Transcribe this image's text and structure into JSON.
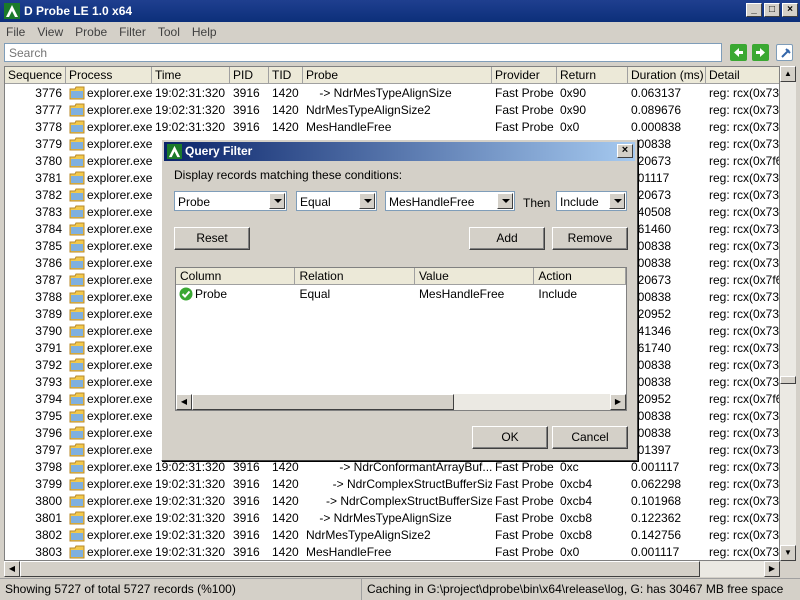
{
  "app": {
    "title": "D Probe LE 1.0 x64"
  },
  "menu": [
    "File",
    "View",
    "Probe",
    "Filter",
    "Tool",
    "Help"
  ],
  "search": {
    "placeholder": "Search"
  },
  "columns": [
    "Sequence",
    "Process",
    "Time",
    "PID",
    "TID",
    "Probe",
    "Provider",
    "Return",
    "Duration (ms)",
    "Detail"
  ],
  "rows": [
    {
      "seq": "3776",
      "proc": "explorer.exe",
      "time": "19:02:31:320",
      "pid": "3916",
      "tid": "1420",
      "probe": "    -> NdrMesTypeAlignSize",
      "prov": "Fast Probe",
      "ret": "0x90",
      "dur": "0.063137",
      "det": "reg: rcx(0x73"
    },
    {
      "seq": "3777",
      "proc": "explorer.exe",
      "time": "19:02:31:320",
      "pid": "3916",
      "tid": "1420",
      "probe": "NdrMesTypeAlignSize2",
      "prov": "Fast Probe",
      "ret": "0x90",
      "dur": "0.089676",
      "det": "reg: rcx(0x73"
    },
    {
      "seq": "3778",
      "proc": "explorer.exe",
      "time": "19:02:31:320",
      "pid": "3916",
      "tid": "1420",
      "probe": "MesHandleFree",
      "prov": "Fast Probe",
      "ret": "0x0",
      "dur": "0.000838",
      "det": "reg: rcx(0x73"
    },
    {
      "seq": "3779",
      "proc": "explorer.exe",
      "time": "",
      "pid": "",
      "tid": "",
      "probe": "",
      "prov": "",
      "ret": "",
      "dur": "000838",
      "det": "reg: rcx(0x73"
    },
    {
      "seq": "3780",
      "proc": "explorer.exe",
      "time": "",
      "pid": "",
      "tid": "",
      "probe": "",
      "prov": "",
      "ret": "",
      "dur": "020673",
      "det": "reg: rcx(0x7f6"
    },
    {
      "seq": "3781",
      "proc": "explorer.exe",
      "time": "",
      "pid": "",
      "tid": "",
      "probe": "",
      "prov": "",
      "ret": "",
      "dur": "001117",
      "det": "reg: rcx(0x73"
    },
    {
      "seq": "3782",
      "proc": "explorer.exe",
      "time": "",
      "pid": "",
      "tid": "",
      "probe": "",
      "prov": "",
      "ret": "",
      "dur": "020673",
      "det": "reg: rcx(0x73"
    },
    {
      "seq": "3783",
      "proc": "explorer.exe",
      "time": "",
      "pid": "",
      "tid": "",
      "probe": "",
      "prov": "",
      "ret": "",
      "dur": "040508",
      "det": "reg: rcx(0x73"
    },
    {
      "seq": "3784",
      "proc": "explorer.exe",
      "time": "",
      "pid": "",
      "tid": "",
      "probe": "",
      "prov": "",
      "ret": "",
      "dur": "061460",
      "det": "reg: rcx(0x73"
    },
    {
      "seq": "3785",
      "proc": "explorer.exe",
      "time": "",
      "pid": "",
      "tid": "",
      "probe": "",
      "prov": "",
      "ret": "",
      "dur": "000838",
      "det": "reg: rcx(0x73"
    },
    {
      "seq": "3786",
      "proc": "explorer.exe",
      "time": "",
      "pid": "",
      "tid": "",
      "probe": "",
      "prov": "",
      "ret": "",
      "dur": "000838",
      "det": "reg: rcx(0x73"
    },
    {
      "seq": "3787",
      "proc": "explorer.exe",
      "time": "",
      "pid": "",
      "tid": "",
      "probe": "",
      "prov": "",
      "ret": "",
      "dur": "020673",
      "det": "reg: rcx(0x7f6"
    },
    {
      "seq": "3788",
      "proc": "explorer.exe",
      "time": "",
      "pid": "",
      "tid": "",
      "probe": "",
      "prov": "",
      "ret": "",
      "dur": "000838",
      "det": "reg: rcx(0x73"
    },
    {
      "seq": "3789",
      "proc": "explorer.exe",
      "time": "",
      "pid": "",
      "tid": "",
      "probe": "",
      "prov": "",
      "ret": "",
      "dur": "020952",
      "det": "reg: rcx(0x73"
    },
    {
      "seq": "3790",
      "proc": "explorer.exe",
      "time": "",
      "pid": "",
      "tid": "",
      "probe": "",
      "prov": "",
      "ret": "",
      "dur": "041346",
      "det": "reg: rcx(0x73"
    },
    {
      "seq": "3791",
      "proc": "explorer.exe",
      "time": "",
      "pid": "",
      "tid": "",
      "probe": "",
      "prov": "",
      "ret": "",
      "dur": "061740",
      "det": "reg: rcx(0x73"
    },
    {
      "seq": "3792",
      "proc": "explorer.exe",
      "time": "",
      "pid": "",
      "tid": "",
      "probe": "",
      "prov": "",
      "ret": "",
      "dur": "000838",
      "det": "reg: rcx(0x73"
    },
    {
      "seq": "3793",
      "proc": "explorer.exe",
      "time": "",
      "pid": "",
      "tid": "",
      "probe": "",
      "prov": "",
      "ret": "",
      "dur": "000838",
      "det": "reg: rcx(0x73"
    },
    {
      "seq": "3794",
      "proc": "explorer.exe",
      "time": "",
      "pid": "",
      "tid": "",
      "probe": "",
      "prov": "",
      "ret": "",
      "dur": "020952",
      "det": "reg: rcx(0x7f6"
    },
    {
      "seq": "3795",
      "proc": "explorer.exe",
      "time": "",
      "pid": "",
      "tid": "",
      "probe": "",
      "prov": "",
      "ret": "",
      "dur": "000838",
      "det": "reg: rcx(0x73"
    },
    {
      "seq": "3796",
      "proc": "explorer.exe",
      "time": "",
      "pid": "",
      "tid": "",
      "probe": "",
      "prov": "",
      "ret": "",
      "dur": "000838",
      "det": "reg: rcx(0x73"
    },
    {
      "seq": "3797",
      "proc": "explorer.exe",
      "time": "",
      "pid": "",
      "tid": "",
      "probe": "",
      "prov": "",
      "ret": "",
      "dur": "001397",
      "det": "reg: rcx(0x73"
    },
    {
      "seq": "3798",
      "proc": "explorer.exe",
      "time": "19:02:31:320",
      "pid": "3916",
      "tid": "1420",
      "probe": "          -> NdrConformantArrayBuf...",
      "prov": "Fast Probe",
      "ret": "0xc",
      "dur": "0.001117",
      "det": "reg: rcx(0x73"
    },
    {
      "seq": "3799",
      "proc": "explorer.exe",
      "time": "19:02:31:320",
      "pid": "3916",
      "tid": "1420",
      "probe": "        -> NdrComplexStructBufferSize",
      "prov": "Fast Probe",
      "ret": "0xcb4",
      "dur": "0.062298",
      "det": "reg: rcx(0x73"
    },
    {
      "seq": "3800",
      "proc": "explorer.exe",
      "time": "19:02:31:320",
      "pid": "3916",
      "tid": "1420",
      "probe": "      -> NdrComplexStructBufferSize",
      "prov": "Fast Probe",
      "ret": "0xcb4",
      "dur": "0.101968",
      "det": "reg: rcx(0x73"
    },
    {
      "seq": "3801",
      "proc": "explorer.exe",
      "time": "19:02:31:320",
      "pid": "3916",
      "tid": "1420",
      "probe": "    -> NdrMesTypeAlignSize",
      "prov": "Fast Probe",
      "ret": "0xcb8",
      "dur": "0.122362",
      "det": "reg: rcx(0x73"
    },
    {
      "seq": "3802",
      "proc": "explorer.exe",
      "time": "19:02:31:320",
      "pid": "3916",
      "tid": "1420",
      "probe": "NdrMesTypeAlignSize2",
      "prov": "Fast Probe",
      "ret": "0xcb8",
      "dur": "0.142756",
      "det": "reg: rcx(0x73"
    },
    {
      "seq": "3803",
      "proc": "explorer.exe",
      "time": "19:02:31:320",
      "pid": "3916",
      "tid": "1420",
      "probe": "MesHandleFree",
      "prov": "Fast Probe",
      "ret": "0x0",
      "dur": "0.001117",
      "det": "reg: rcx(0x73"
    }
  ],
  "status": {
    "left": "Showing 5727 of total 5727 records (%100)",
    "right": "Caching in G:\\project\\dprobe\\bin\\x64\\release\\log, G: has 30467 MB free space"
  },
  "dialog": {
    "title": "Query Filter",
    "label": "Display records matching these conditions:",
    "column_value": "Probe",
    "relation_value": "Equal",
    "value_value": "MesHandleFree",
    "then_label": "Then",
    "action_value": "Include",
    "reset_label": "Reset",
    "add_label": "Add",
    "remove_label": "Remove",
    "list_columns": [
      "Column",
      "Relation",
      "Value",
      "Action"
    ],
    "list_rows": [
      {
        "column": "Probe",
        "relation": "Equal",
        "value": "MesHandleFree",
        "action": "Include"
      }
    ],
    "ok_label": "OK",
    "cancel_label": "Cancel"
  },
  "colors": {
    "title_bar": "#0c2f7a",
    "dialog_title": "#0a246a",
    "nav_green": "#3aa832"
  }
}
